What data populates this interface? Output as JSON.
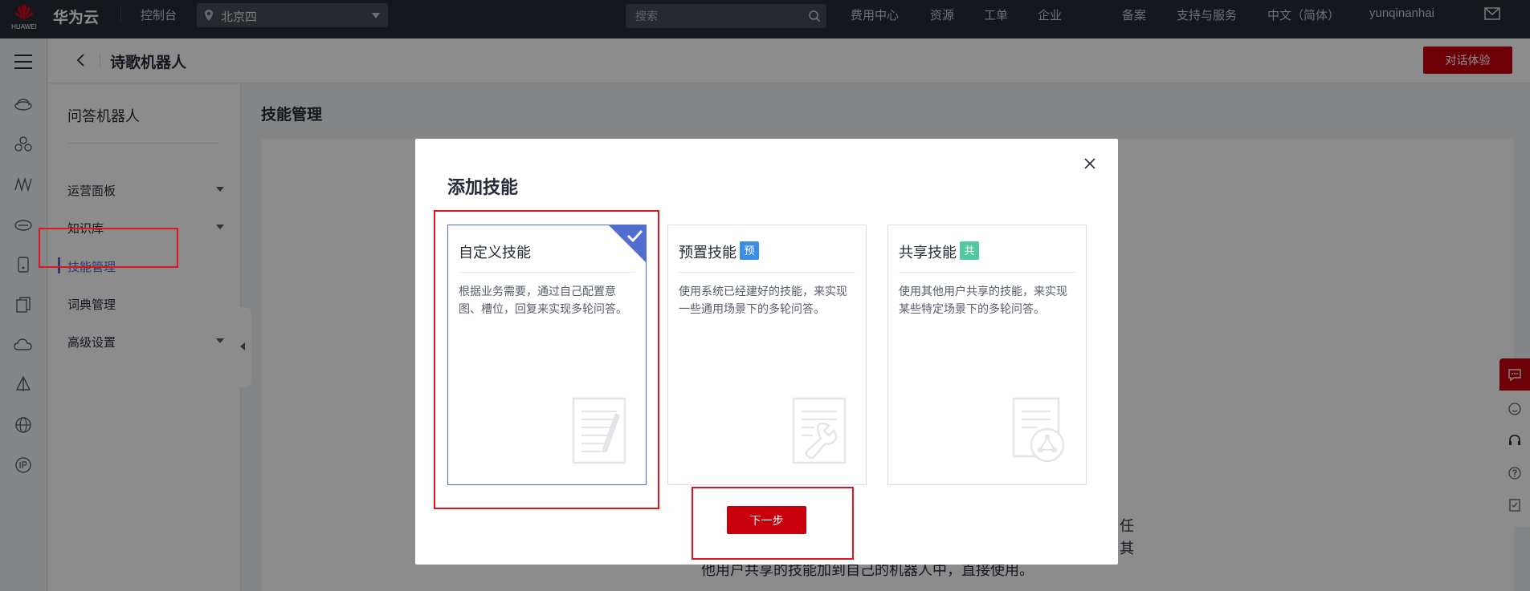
{
  "topbar": {
    "logo_text": "HUAWEI",
    "brand": "华为云",
    "console": "控制台",
    "region": "北京四",
    "search_placeholder": "搜索",
    "nav": [
      "费用中心",
      "资源",
      "工单",
      "企业",
      "备案",
      "支持与服务",
      "中文（简体）",
      "yunqinanhai"
    ]
  },
  "header": {
    "title": "诗歌机器人",
    "action_button": "对话体验"
  },
  "sidebar": {
    "title": "问答机器人",
    "items": [
      {
        "label": "运营面板",
        "expandable": true
      },
      {
        "label": "知识库",
        "expandable": true
      },
      {
        "label": "技能管理",
        "active": true
      },
      {
        "label": "词典管理"
      },
      {
        "label": "高级设置",
        "expandable": true
      }
    ]
  },
  "main": {
    "title": "技能管理",
    "background_text": [
      "任",
      "其",
      "他用户共享的技能加到自己的机器人中，直接使用。"
    ]
  },
  "modal": {
    "title": "添加技能",
    "cards": [
      {
        "name": "自定义技能",
        "badge": "",
        "desc": "根据业务需要，通过自己配置意图、槽位，回复来实现多轮问答。",
        "selected": true,
        "icon": "document-pen-icon"
      },
      {
        "name": "预置技能",
        "badge": "预",
        "badge_color": "#3a8ee6",
        "desc": "使用系统已经建好的技能，来实现一些通用场景下的多轮问答。",
        "selected": false,
        "icon": "document-wrench-icon"
      },
      {
        "name": "共享技能",
        "badge": "共",
        "badge_color": "#50c8a0",
        "desc": "使用其他用户共享的技能，来实现某些特定场景下的多轮问答。",
        "selected": false,
        "icon": "document-share-icon"
      }
    ],
    "next_button": "下一步"
  },
  "colors": {
    "brand_red": "#c7000b",
    "active_blue": "#526ecc",
    "annotation_red": "#e0141e"
  }
}
